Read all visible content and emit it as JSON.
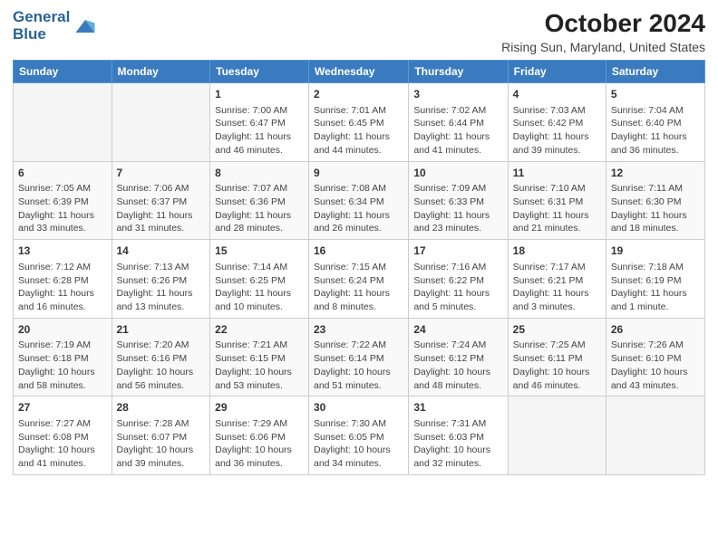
{
  "header": {
    "logo_line1": "General",
    "logo_line2": "Blue",
    "main_title": "October 2024",
    "subtitle": "Rising Sun, Maryland, United States"
  },
  "weekdays": [
    "Sunday",
    "Monday",
    "Tuesday",
    "Wednesday",
    "Thursday",
    "Friday",
    "Saturday"
  ],
  "weeks": [
    [
      {
        "day": "",
        "empty": true
      },
      {
        "day": "",
        "empty": true
      },
      {
        "day": "1",
        "sunrise": "Sunrise: 7:00 AM",
        "sunset": "Sunset: 6:47 PM",
        "daylight": "Daylight: 11 hours and 46 minutes."
      },
      {
        "day": "2",
        "sunrise": "Sunrise: 7:01 AM",
        "sunset": "Sunset: 6:45 PM",
        "daylight": "Daylight: 11 hours and 44 minutes."
      },
      {
        "day": "3",
        "sunrise": "Sunrise: 7:02 AM",
        "sunset": "Sunset: 6:44 PM",
        "daylight": "Daylight: 11 hours and 41 minutes."
      },
      {
        "day": "4",
        "sunrise": "Sunrise: 7:03 AM",
        "sunset": "Sunset: 6:42 PM",
        "daylight": "Daylight: 11 hours and 39 minutes."
      },
      {
        "day": "5",
        "sunrise": "Sunrise: 7:04 AM",
        "sunset": "Sunset: 6:40 PM",
        "daylight": "Daylight: 11 hours and 36 minutes."
      }
    ],
    [
      {
        "day": "6",
        "sunrise": "Sunrise: 7:05 AM",
        "sunset": "Sunset: 6:39 PM",
        "daylight": "Daylight: 11 hours and 33 minutes."
      },
      {
        "day": "7",
        "sunrise": "Sunrise: 7:06 AM",
        "sunset": "Sunset: 6:37 PM",
        "daylight": "Daylight: 11 hours and 31 minutes."
      },
      {
        "day": "8",
        "sunrise": "Sunrise: 7:07 AM",
        "sunset": "Sunset: 6:36 PM",
        "daylight": "Daylight: 11 hours and 28 minutes."
      },
      {
        "day": "9",
        "sunrise": "Sunrise: 7:08 AM",
        "sunset": "Sunset: 6:34 PM",
        "daylight": "Daylight: 11 hours and 26 minutes."
      },
      {
        "day": "10",
        "sunrise": "Sunrise: 7:09 AM",
        "sunset": "Sunset: 6:33 PM",
        "daylight": "Daylight: 11 hours and 23 minutes."
      },
      {
        "day": "11",
        "sunrise": "Sunrise: 7:10 AM",
        "sunset": "Sunset: 6:31 PM",
        "daylight": "Daylight: 11 hours and 21 minutes."
      },
      {
        "day": "12",
        "sunrise": "Sunrise: 7:11 AM",
        "sunset": "Sunset: 6:30 PM",
        "daylight": "Daylight: 11 hours and 18 minutes."
      }
    ],
    [
      {
        "day": "13",
        "sunrise": "Sunrise: 7:12 AM",
        "sunset": "Sunset: 6:28 PM",
        "daylight": "Daylight: 11 hours and 16 minutes."
      },
      {
        "day": "14",
        "sunrise": "Sunrise: 7:13 AM",
        "sunset": "Sunset: 6:26 PM",
        "daylight": "Daylight: 11 hours and 13 minutes."
      },
      {
        "day": "15",
        "sunrise": "Sunrise: 7:14 AM",
        "sunset": "Sunset: 6:25 PM",
        "daylight": "Daylight: 11 hours and 10 minutes."
      },
      {
        "day": "16",
        "sunrise": "Sunrise: 7:15 AM",
        "sunset": "Sunset: 6:24 PM",
        "daylight": "Daylight: 11 hours and 8 minutes."
      },
      {
        "day": "17",
        "sunrise": "Sunrise: 7:16 AM",
        "sunset": "Sunset: 6:22 PM",
        "daylight": "Daylight: 11 hours and 5 minutes."
      },
      {
        "day": "18",
        "sunrise": "Sunrise: 7:17 AM",
        "sunset": "Sunset: 6:21 PM",
        "daylight": "Daylight: 11 hours and 3 minutes."
      },
      {
        "day": "19",
        "sunrise": "Sunrise: 7:18 AM",
        "sunset": "Sunset: 6:19 PM",
        "daylight": "Daylight: 11 hours and 1 minute."
      }
    ],
    [
      {
        "day": "20",
        "sunrise": "Sunrise: 7:19 AM",
        "sunset": "Sunset: 6:18 PM",
        "daylight": "Daylight: 10 hours and 58 minutes."
      },
      {
        "day": "21",
        "sunrise": "Sunrise: 7:20 AM",
        "sunset": "Sunset: 6:16 PM",
        "daylight": "Daylight: 10 hours and 56 minutes."
      },
      {
        "day": "22",
        "sunrise": "Sunrise: 7:21 AM",
        "sunset": "Sunset: 6:15 PM",
        "daylight": "Daylight: 10 hours and 53 minutes."
      },
      {
        "day": "23",
        "sunrise": "Sunrise: 7:22 AM",
        "sunset": "Sunset: 6:14 PM",
        "daylight": "Daylight: 10 hours and 51 minutes."
      },
      {
        "day": "24",
        "sunrise": "Sunrise: 7:24 AM",
        "sunset": "Sunset: 6:12 PM",
        "daylight": "Daylight: 10 hours and 48 minutes."
      },
      {
        "day": "25",
        "sunrise": "Sunrise: 7:25 AM",
        "sunset": "Sunset: 6:11 PM",
        "daylight": "Daylight: 10 hours and 46 minutes."
      },
      {
        "day": "26",
        "sunrise": "Sunrise: 7:26 AM",
        "sunset": "Sunset: 6:10 PM",
        "daylight": "Daylight: 10 hours and 43 minutes."
      }
    ],
    [
      {
        "day": "27",
        "sunrise": "Sunrise: 7:27 AM",
        "sunset": "Sunset: 6:08 PM",
        "daylight": "Daylight: 10 hours and 41 minutes."
      },
      {
        "day": "28",
        "sunrise": "Sunrise: 7:28 AM",
        "sunset": "Sunset: 6:07 PM",
        "daylight": "Daylight: 10 hours and 39 minutes."
      },
      {
        "day": "29",
        "sunrise": "Sunrise: 7:29 AM",
        "sunset": "Sunset: 6:06 PM",
        "daylight": "Daylight: 10 hours and 36 minutes."
      },
      {
        "day": "30",
        "sunrise": "Sunrise: 7:30 AM",
        "sunset": "Sunset: 6:05 PM",
        "daylight": "Daylight: 10 hours and 34 minutes."
      },
      {
        "day": "31",
        "sunrise": "Sunrise: 7:31 AM",
        "sunset": "Sunset: 6:03 PM",
        "daylight": "Daylight: 10 hours and 32 minutes."
      },
      {
        "day": "",
        "empty": true
      },
      {
        "day": "",
        "empty": true
      }
    ]
  ]
}
